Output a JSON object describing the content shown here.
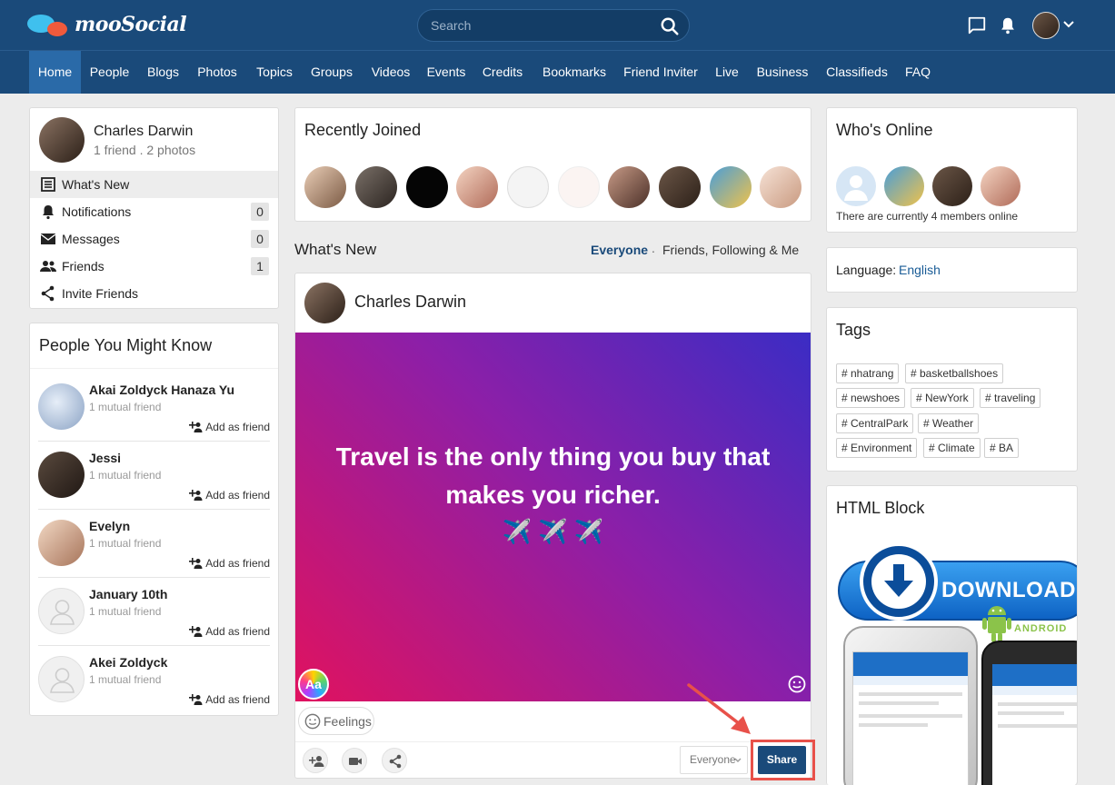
{
  "header": {
    "logo_text": "mooSocial",
    "search_placeholder": "Search"
  },
  "nav": [
    "Home",
    "People",
    "Blogs",
    "Photos",
    "Topics",
    "Groups",
    "Videos",
    "Events",
    "Credits",
    "Bookmarks",
    "Friend Inviter",
    "Live",
    "Business",
    "Classifieds",
    "FAQ"
  ],
  "profile": {
    "name": "Charles Darwin",
    "stats": "1 friend . 2 photos",
    "menu": [
      {
        "label": "What's New",
        "count": null
      },
      {
        "label": "Notifications",
        "count": "0"
      },
      {
        "label": "Messages",
        "count": "0"
      },
      {
        "label": "Friends",
        "count": "1"
      },
      {
        "label": "Invite Friends",
        "count": null
      }
    ]
  },
  "pymk": {
    "title": "People You Might Know",
    "people": [
      {
        "name": "Akai Zoldyck Hanaza Yu",
        "mutual": "1 mutual friend",
        "action": "Add as friend"
      },
      {
        "name": "Jessi",
        "mutual": "1 mutual friend",
        "action": "Add as friend"
      },
      {
        "name": "Evelyn",
        "mutual": "1 mutual friend",
        "action": "Add as friend"
      },
      {
        "name": "January 10th",
        "mutual": "1 mutual friend",
        "action": "Add as friend"
      },
      {
        "name": "Akei Zoldyck",
        "mutual": "1 mutual friend",
        "action": "Add as friend"
      }
    ]
  },
  "recently_joined": {
    "title": "Recently Joined"
  },
  "whats_new": {
    "title": "What's New",
    "filter_active": "Everyone",
    "filter_sep": ".",
    "filter_other": "Friends, Following & Me"
  },
  "composer": {
    "author": "Charles Darwin",
    "text_line1": "Travel is the only thing you buy that",
    "text_line2": "makes you richer.",
    "emojis": "✈️ ✈️ ✈️",
    "aa_label": "Aa",
    "feelings_label": "Feelings",
    "privacy_value": "Everyone",
    "share_label": "Share"
  },
  "whos_online": {
    "title": "Who's Online",
    "summary": "There are currently 4 members online"
  },
  "language": {
    "label": "Language:",
    "value": "English"
  },
  "tags": {
    "title": "Tags",
    "items": [
      "# nhatrang",
      "# basketballshoes",
      "# newshoes",
      "# NewYork",
      "# traveling",
      "# CentralPark",
      "# Weather",
      "# Environment",
      "# Climate",
      "# BA"
    ]
  },
  "html_block": {
    "title": "HTML Block",
    "download_label": "DOWNLOAD",
    "android_label": "ANDROID"
  },
  "colors": {
    "primary": "#1a4a7a",
    "active_nav": "#2a6aa8",
    "share": "#1a4a7a",
    "annotation": "#e8514a"
  }
}
